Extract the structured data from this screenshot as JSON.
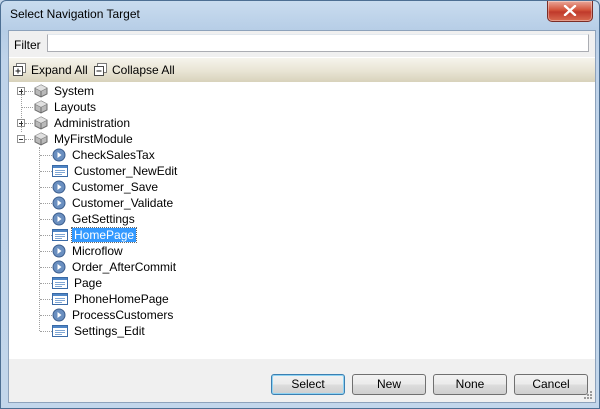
{
  "window": {
    "title": "Select Navigation Target"
  },
  "filter": {
    "label": "Filter",
    "value": ""
  },
  "toolbar": {
    "expand_all": "Expand All",
    "collapse_all": "Collapse All"
  },
  "tree": {
    "modules": [
      {
        "label": "System",
        "icon": "module-icon",
        "expander": "plus"
      },
      {
        "label": "Layouts",
        "icon": "module-icon",
        "expander": "none"
      },
      {
        "label": "Administration",
        "icon": "module-icon",
        "expander": "plus"
      },
      {
        "label": "MyFirstModule",
        "icon": "module-icon",
        "expander": "minus"
      }
    ],
    "children": [
      {
        "label": "CheckSalesTax",
        "icon": "microflow-icon"
      },
      {
        "label": "Customer_NewEdit",
        "icon": "page-icon"
      },
      {
        "label": "Customer_Save",
        "icon": "microflow-icon"
      },
      {
        "label": "Customer_Validate",
        "icon": "microflow-icon"
      },
      {
        "label": "GetSettings",
        "icon": "microflow-icon"
      },
      {
        "label": "HomePage",
        "icon": "page-icon",
        "selected": true
      },
      {
        "label": "Microflow",
        "icon": "microflow-icon"
      },
      {
        "label": "Order_AfterCommit",
        "icon": "microflow-icon"
      },
      {
        "label": "Page",
        "icon": "page-icon"
      },
      {
        "label": "PhoneHomePage",
        "icon": "page-icon"
      },
      {
        "label": "ProcessCustomers",
        "icon": "microflow-icon"
      },
      {
        "label": "Settings_Edit",
        "icon": "page-icon"
      }
    ]
  },
  "buttons": {
    "select": "Select",
    "new": "New",
    "none": "None",
    "cancel": "Cancel"
  },
  "colors": {
    "selection": "#3399ff",
    "titlebar": "#b9d1ea",
    "close": "#c7432f"
  }
}
